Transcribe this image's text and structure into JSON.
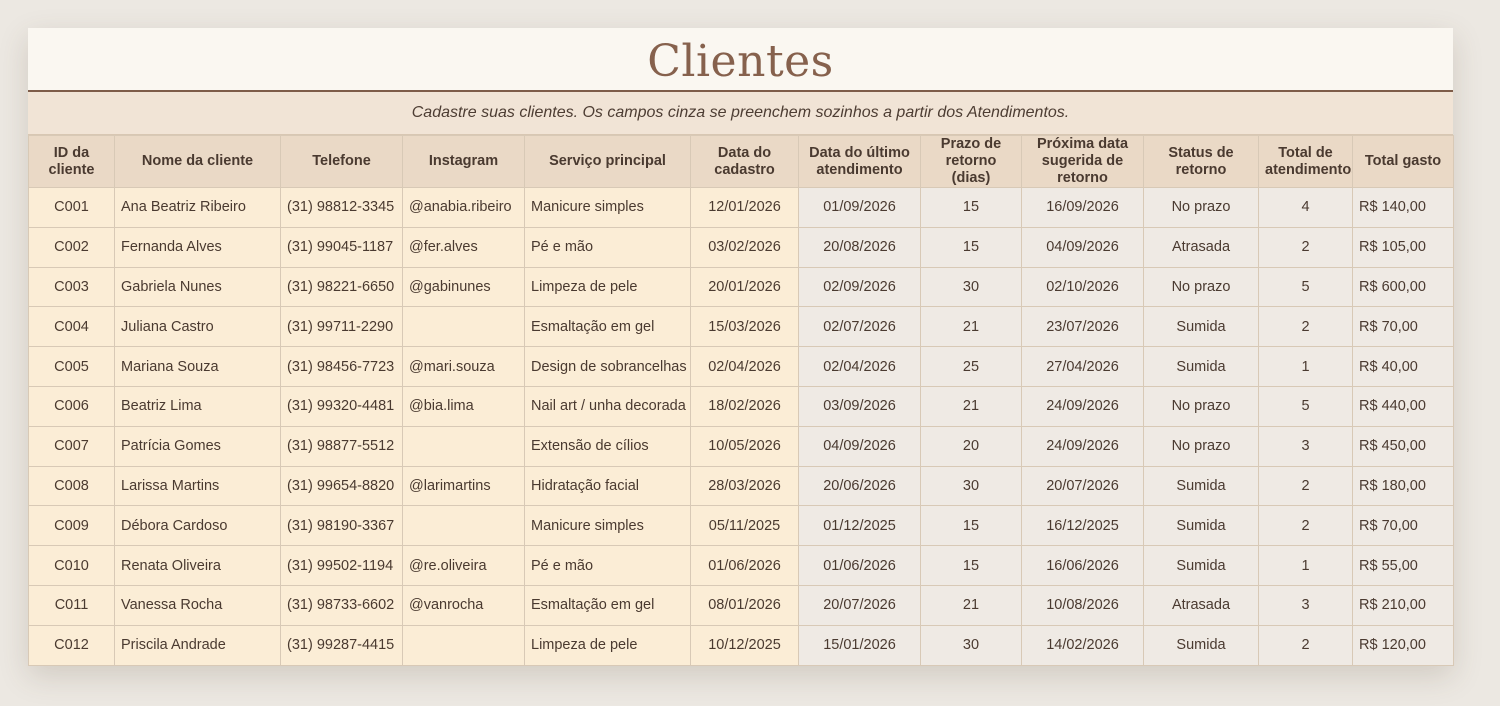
{
  "title": "Clientes",
  "subtitle": "Cadastre suas clientes. Os campos cinza se preenchem sozinhos a partir dos Atendimentos.",
  "colors": {
    "title": "#86614d",
    "header_bg": "#ead9c6",
    "input_cell": "#fbedd6",
    "auto_cell": "#efeae4",
    "subtitle_bg": "#f1e4d6"
  },
  "columns": [
    {
      "label": "ID da cliente"
    },
    {
      "label": "Nome da cliente"
    },
    {
      "label": "Telefone"
    },
    {
      "label": "Instagram"
    },
    {
      "label": "Serviço principal"
    },
    {
      "label": "Data do cadastro"
    },
    {
      "label": "Data do último atendimento"
    },
    {
      "label": "Prazo de retorno (dias)"
    },
    {
      "label": "Próxima data sugerida de retorno"
    },
    {
      "label": "Status de retorno"
    },
    {
      "label": "Total de atendimentos"
    },
    {
      "label": "Total gasto"
    }
  ],
  "rows": [
    [
      "C001",
      "Ana Beatriz Ribeiro",
      "(31) 98812-3345",
      "@anabia.ribeiro",
      "Manicure simples",
      "12/01/2026",
      "01/09/2026",
      "15",
      "16/09/2026",
      "No prazo",
      "4",
      "R$ 140,00"
    ],
    [
      "C002",
      "Fernanda Alves",
      "(31) 99045-1187",
      "@fer.alves",
      "Pé e mão",
      "03/02/2026",
      "20/08/2026",
      "15",
      "04/09/2026",
      "Atrasada",
      "2",
      "R$ 105,00"
    ],
    [
      "C003",
      "Gabriela Nunes",
      "(31) 98221-6650",
      "@gabinunes",
      "Limpeza de pele",
      "20/01/2026",
      "02/09/2026",
      "30",
      "02/10/2026",
      "No prazo",
      "5",
      "R$ 600,00"
    ],
    [
      "C004",
      "Juliana Castro",
      "(31) 99711-2290",
      "",
      "Esmaltação em gel",
      "15/03/2026",
      "02/07/2026",
      "21",
      "23/07/2026",
      "Sumida",
      "2",
      "R$ 70,00"
    ],
    [
      "C005",
      "Mariana Souza",
      "(31) 98456-7723",
      "@mari.souza",
      "Design de sobrancelhas",
      "02/04/2026",
      "02/04/2026",
      "25",
      "27/04/2026",
      "Sumida",
      "1",
      "R$ 40,00"
    ],
    [
      "C006",
      "Beatriz Lima",
      "(31) 99320-4481",
      "@bia.lima",
      "Nail art / unha decorada",
      "18/02/2026",
      "03/09/2026",
      "21",
      "24/09/2026",
      "No prazo",
      "5",
      "R$ 440,00"
    ],
    [
      "C007",
      "Patrícia Gomes",
      "(31) 98877-5512",
      "",
      "Extensão de cílios",
      "10/05/2026",
      "04/09/2026",
      "20",
      "24/09/2026",
      "No prazo",
      "3",
      "R$ 450,00"
    ],
    [
      "C008",
      "Larissa Martins",
      "(31) 99654-8820",
      "@larimartins",
      "Hidratação facial",
      "28/03/2026",
      "20/06/2026",
      "30",
      "20/07/2026",
      "Sumida",
      "2",
      "R$ 180,00"
    ],
    [
      "C009",
      "Débora Cardoso",
      "(31) 98190-3367",
      "",
      "Manicure simples",
      "05/11/2025",
      "01/12/2025",
      "15",
      "16/12/2025",
      "Sumida",
      "2",
      "R$ 70,00"
    ],
    [
      "C010",
      "Renata Oliveira",
      "(31) 99502-1194",
      "@re.oliveira",
      "Pé e mão",
      "01/06/2026",
      "01/06/2026",
      "15",
      "16/06/2026",
      "Sumida",
      "1",
      "R$ 55,00"
    ],
    [
      "C011",
      "Vanessa Rocha",
      "(31) 98733-6602",
      "@vanrocha",
      "Esmaltação em gel",
      "08/01/2026",
      "20/07/2026",
      "21",
      "10/08/2026",
      "Atrasada",
      "3",
      "R$ 210,00"
    ],
    [
      "C012",
      "Priscila Andrade",
      "(31) 99287-4415",
      "",
      "Limpeza de pele",
      "10/12/2025",
      "15/01/2026",
      "30",
      "14/02/2026",
      "Sumida",
      "2",
      "R$ 120,00"
    ]
  ]
}
